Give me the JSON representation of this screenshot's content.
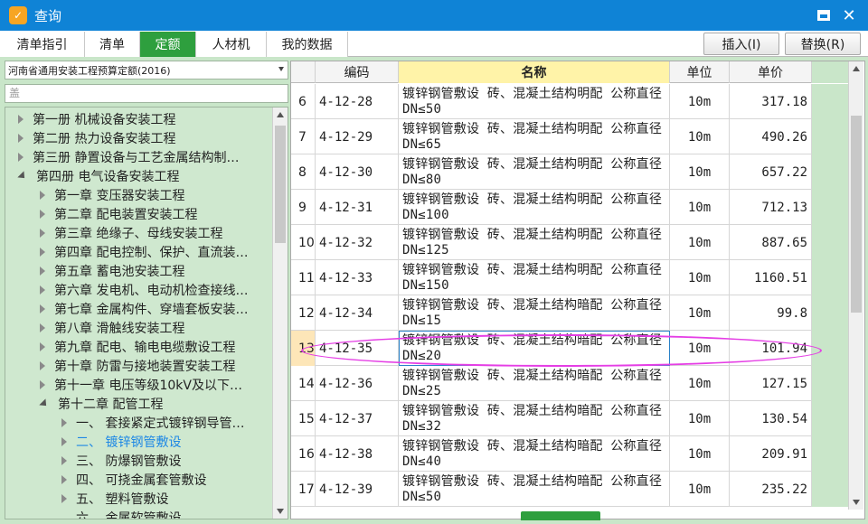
{
  "window": {
    "title": "查询",
    "icon": "app-logo-icon",
    "restore_icon": "restore-icon",
    "close_icon": "close-icon"
  },
  "tabs": [
    {
      "label": "清单指引",
      "active": false
    },
    {
      "label": "清单",
      "active": false
    },
    {
      "label": "定额",
      "active": true
    },
    {
      "label": "人材机",
      "active": false
    },
    {
      "label": "我的数据",
      "active": false
    }
  ],
  "actions": {
    "insert_label": "插入(I)",
    "replace_label": "替换(R)"
  },
  "left": {
    "quota_selected": "河南省通用安装工程预算定额(2016)",
    "search_placeholder": "盖",
    "tree": [
      {
        "label": "第一册 机械设备安装工程",
        "state": "closed",
        "level": 0
      },
      {
        "label": "第二册 热力设备安装工程",
        "state": "closed",
        "level": 0
      },
      {
        "label": "第三册 静置设备与工艺金属结构制…",
        "state": "closed",
        "level": 0
      },
      {
        "label": "第四册 电气设备安装工程",
        "state": "open",
        "level": 0
      },
      {
        "label": "第一章 变压器安装工程",
        "state": "closed",
        "level": 1
      },
      {
        "label": "第二章 配电装置安装工程",
        "state": "closed",
        "level": 1
      },
      {
        "label": "第三章 绝缘子、母线安装工程",
        "state": "closed",
        "level": 1
      },
      {
        "label": "第四章 配电控制、保护、直流装…",
        "state": "closed",
        "level": 1
      },
      {
        "label": "第五章 蓄电池安装工程",
        "state": "closed",
        "level": 1
      },
      {
        "label": "第六章 发电机、电动机检查接线…",
        "state": "closed",
        "level": 1
      },
      {
        "label": "第七章 金属构件、穿墙套板安装…",
        "state": "closed",
        "level": 1
      },
      {
        "label": "第八章 滑触线安装工程",
        "state": "closed",
        "level": 1
      },
      {
        "label": "第九章 配电、输电电缆敷设工程",
        "state": "closed",
        "level": 1
      },
      {
        "label": "第十章 防雷与接地装置安装工程",
        "state": "closed",
        "level": 1
      },
      {
        "label": "第十一章 电压等级10kV及以下…",
        "state": "closed",
        "level": 1
      },
      {
        "label": "第十二章 配管工程",
        "state": "open",
        "level": 1
      },
      {
        "label": "一、 套接紧定式镀锌钢导管…",
        "state": "closed",
        "level": 2
      },
      {
        "label": "二、 镀锌钢管敷设",
        "state": "closed",
        "level": 2,
        "selected": true
      },
      {
        "label": "三、 防爆钢管敷设",
        "state": "closed",
        "level": 2
      },
      {
        "label": "四、 可挠金属套管敷设",
        "state": "closed",
        "level": 2
      },
      {
        "label": "五、 塑料管敷设",
        "state": "closed",
        "level": 2
      },
      {
        "label": "六、 金属软管敷设",
        "state": "none",
        "level": 2
      }
    ]
  },
  "grid": {
    "headers": {
      "code": "编码",
      "name": "名称",
      "unit": "单位",
      "price": "单价"
    },
    "rows": [
      {
        "num": "6",
        "code": "4-12-28",
        "name": "镀锌钢管敷设 砖、混凝土结构明配 公称直径DN≤50",
        "unit": "10m",
        "price": "317.18"
      },
      {
        "num": "7",
        "code": "4-12-29",
        "name": "镀锌钢管敷设 砖、混凝土结构明配 公称直径DN≤65",
        "unit": "10m",
        "price": "490.26"
      },
      {
        "num": "8",
        "code": "4-12-30",
        "name": "镀锌钢管敷设 砖、混凝土结构明配 公称直径DN≤80",
        "unit": "10m",
        "price": "657.22"
      },
      {
        "num": "9",
        "code": "4-12-31",
        "name": "镀锌钢管敷设 砖、混凝土结构明配 公称直径DN≤100",
        "unit": "10m",
        "price": "712.13"
      },
      {
        "num": "10",
        "code": "4-12-32",
        "name": "镀锌钢管敷设 砖、混凝土结构明配 公称直径DN≤125",
        "unit": "10m",
        "price": "887.65"
      },
      {
        "num": "11",
        "code": "4-12-33",
        "name": "镀锌钢管敷设 砖、混凝土结构明配 公称直径DN≤150",
        "unit": "10m",
        "price": "1160.51"
      },
      {
        "num": "12",
        "code": "4-12-34",
        "name": "镀锌钢管敷设 砖、混凝土结构暗配 公称直径DN≤15",
        "unit": "10m",
        "price": "99.8"
      },
      {
        "num": "13",
        "code": "4-12-35",
        "name": "镀锌钢管敷设 砖、混凝土结构暗配 公称直径DN≤20",
        "unit": "10m",
        "price": "101.94",
        "highlight": true
      },
      {
        "num": "14",
        "code": "4-12-36",
        "name": "镀锌钢管敷设 砖、混凝土结构暗配 公称直径DN≤25",
        "unit": "10m",
        "price": "127.15"
      },
      {
        "num": "15",
        "code": "4-12-37",
        "name": "镀锌钢管敷设 砖、混凝土结构暗配 公称直径DN≤32",
        "unit": "10m",
        "price": "130.54"
      },
      {
        "num": "16",
        "code": "4-12-38",
        "name": "镀锌钢管敷设 砖、混凝土结构暗配 公称直径DN≤40",
        "unit": "10m",
        "price": "209.91"
      },
      {
        "num": "17",
        "code": "4-12-39",
        "name": "镀锌钢管敷设 砖、混凝土结构暗配 公称直径DN≤50",
        "unit": "10m",
        "price": "235.22"
      }
    ]
  },
  "colors": {
    "titlebar": "#0f83d6",
    "active_tab": "#2e9f3e",
    "panel_bg": "#c9e6c9",
    "selected_text": "#1e88e5",
    "annotation": "#e53ee5",
    "header_highlight": "#fff3a8"
  }
}
